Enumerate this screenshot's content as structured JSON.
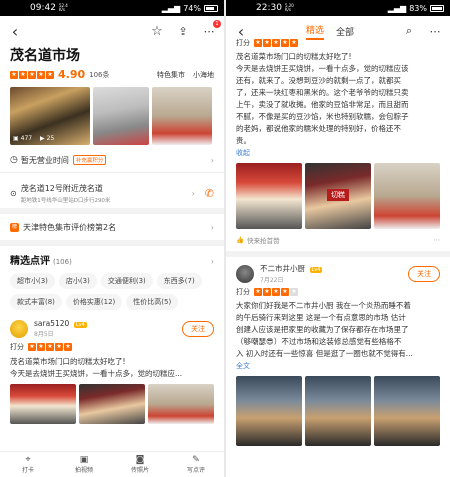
{
  "left": {
    "status": {
      "time": "09:42",
      "net_speed": "52.4 K/s",
      "battery": "74%"
    },
    "shop": {
      "name": "茂名道市场",
      "rating": "4.90",
      "reviews": "106条",
      "category1": "特色集市",
      "category2": "小海地",
      "photo_count1": "477",
      "photo_count2": "25",
      "business_status": "暂无营业时间",
      "points_badge": "补充赢积分",
      "address": "茂名道12号附近茂名道",
      "distance": "距地铁1号线华山里站D口步行290米",
      "ranking": "天津特色集市评价榜第2名",
      "badge_count": "1"
    },
    "reviews_section": {
      "title": "精选点评",
      "count": "(106)",
      "tags": [
        "超市小(3)",
        "店小(3)",
        "交通便利(3)",
        "东西多(7)",
        "款式丰富(8)",
        "价格实惠(12)",
        "性价比高(5)"
      ]
    },
    "review": {
      "user": "sara5120",
      "level": "Lv4",
      "date": "8月5日",
      "score_label": "打分",
      "follow": "关注",
      "line1": "茂名道菜市场门口的切糕太好吃了!",
      "line2": "今天是去烧饼王买烧饼，一看十点多，觉的切糕应..."
    },
    "tabbar": [
      {
        "label": "打卡",
        "icon": "map-pin-icon"
      },
      {
        "label": "拍视频",
        "icon": "video-icon"
      },
      {
        "label": "传照片",
        "icon": "camera-icon"
      },
      {
        "label": "写点评",
        "icon": "pencil-icon"
      }
    ]
  },
  "right": {
    "status": {
      "time": "22:30",
      "net_speed": "5.20 K/s",
      "battery": "83%"
    },
    "tabs": {
      "active": "精选",
      "other": "全部"
    },
    "review1": {
      "score_label": "打分",
      "lines": [
        "茂名道菜市场门口的切糕太好吃了!",
        "今天是去烧饼王买烧饼，一看十点多，觉的切糕应该",
        "还有，就来了。没想到豆沙的就剩一点了，就都买",
        "了，还来一块红枣和黑米的。这个老爷爷的切糕只卖",
        "上午，卖没了就收摊。他家的豆馅非常足，而且甜而",
        "不腻，不像是买的豆沙馅，米也特别软糯，会包粽子",
        "的老妈，都说他家的糯米处理的特别好，价格还不",
        "贵。"
      ],
      "collapse": "收起",
      "photo_sign": "切糕",
      "recommend": "快来抢首赞"
    },
    "review2": {
      "user": "不二市井小厨",
      "level": "Lv4",
      "date": "7月22日",
      "score_label": "打分",
      "follow": "关注",
      "lines": [
        "大家你们好我是不二市井小厨 我在一个炎热而睡不着",
        "的午后骑行来到这里 这是一个有点意思的市场 估计",
        "创建人应该是把家里的收藏为了保存都存在市场里了",
        "（够嘲瑟😎）不过市场和这装修总感觉有些格格不",
        "入 初入时还有一些惊喜 但是逛了一圈也就不觉得有..."
      ],
      "full": "全文"
    }
  }
}
